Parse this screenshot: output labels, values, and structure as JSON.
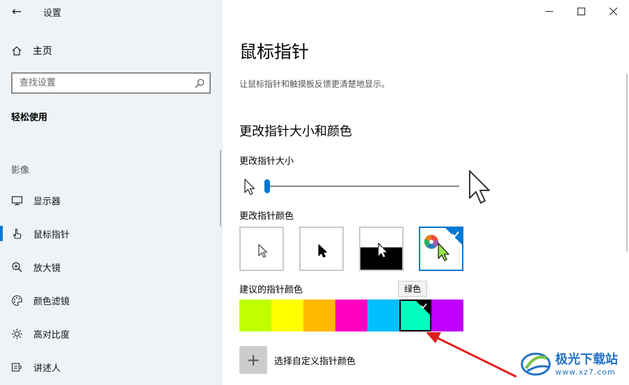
{
  "sidebar": {
    "app_title": "设置",
    "home_label": "主页",
    "search_placeholder": "查找设置",
    "group_title": "轻松使用",
    "section_label": "影像",
    "items": [
      {
        "label": "显示器",
        "icon": "monitor-icon"
      },
      {
        "label": "鼠标指针",
        "icon": "mouse-pointer-hand-icon",
        "active": true
      },
      {
        "label": "放大镜",
        "icon": "magnifier-icon"
      },
      {
        "label": "颜色滤镜",
        "icon": "palette-icon"
      },
      {
        "label": "高对比度",
        "icon": "sun-icon"
      },
      {
        "label": "讲述人",
        "icon": "narrator-icon"
      }
    ]
  },
  "main": {
    "title": "鼠标指针",
    "description": "让鼠标指针和触摸板反馈更清楚地显示。",
    "section_title": "更改指针大小和颜色",
    "size_label": "更改指针大小",
    "size_value": 1,
    "color_label": "更改指针颜色",
    "pointer_styles": [
      "white",
      "black",
      "inverted",
      "custom"
    ],
    "selected_style": "custom",
    "suggested_label": "建议的指针颜色",
    "swatches": [
      "#bfff00",
      "#ffff00",
      "#ffb900",
      "#ff00bf",
      "#00bfff",
      "#00ffbf",
      "#bf00ff"
    ],
    "selected_swatch_index": 5,
    "tooltip": "绿色",
    "custom_label": "选择自定义指针颜色",
    "accent_color": "#0078d4"
  },
  "watermark": {
    "line1": "极光下载站",
    "line2": "www.xz7.com"
  }
}
